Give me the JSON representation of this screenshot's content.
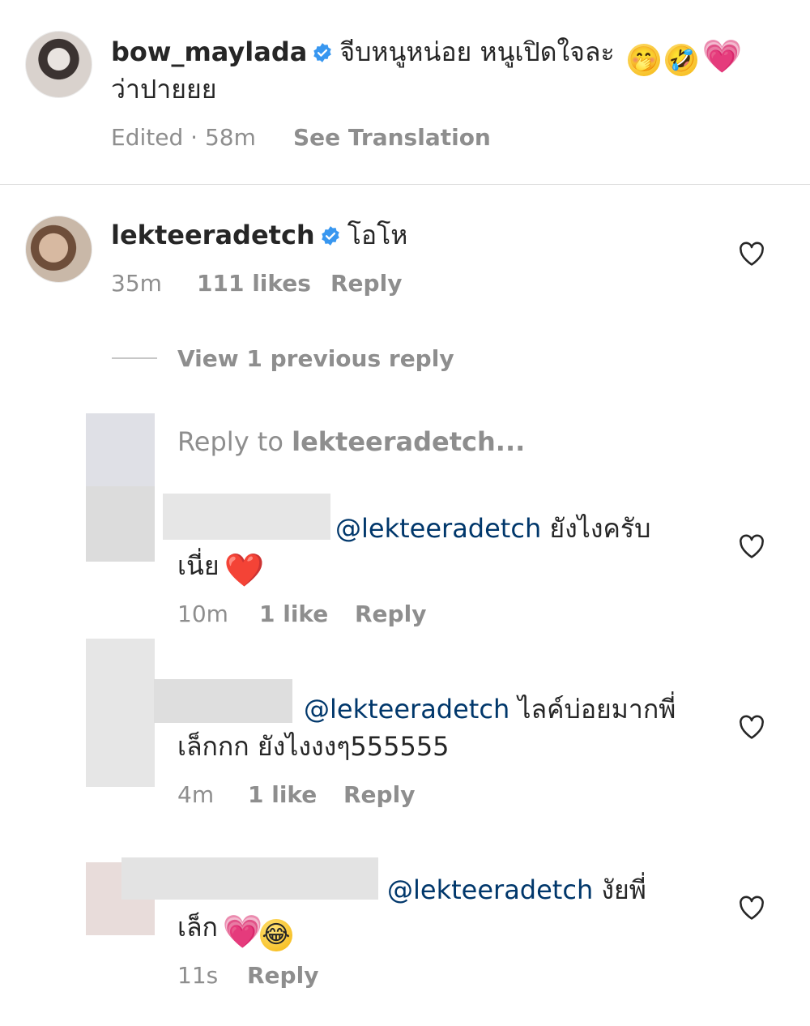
{
  "caption": {
    "username": "bow_maylada",
    "text_line1": "จีบหนูหน่อย หนูเปิดใจละ",
    "text_line2": "ว่าปายยย",
    "emojis": [
      "🤭",
      "🤣",
      "💗"
    ],
    "edited": "Edited",
    "time": "58m",
    "see_translation": "See Translation"
  },
  "comment": {
    "username": "lekteeradetch",
    "text": "โอโห",
    "time": "35m",
    "likes": "111 likes",
    "reply": "Reply",
    "view_previous": "View 1 previous reply",
    "reply_to": "Reply to",
    "reply_to_user": "lekteeradetch..."
  },
  "replies": [
    {
      "mention": "@lekteeradetch",
      "text_line1": "ยังไงครับ",
      "text_line2": "เนี่ย",
      "emoji": "❤️",
      "time": "10m",
      "likes": "1 like",
      "reply": "Reply"
    },
    {
      "mention": "@lekteeradetch",
      "text_line1": "ไลค์บ่อยมากพี่",
      "text_line2": "เล็กกก ยังไงงงๆ555555",
      "time": "4m",
      "likes": "1 like",
      "reply": "Reply"
    },
    {
      "mention": "@lekteeradetch",
      "text_line1": "งัยพี่",
      "text_line2": "เล็ก",
      "emojis": [
        "💗",
        "😂"
      ],
      "time": "11s",
      "reply": "Reply"
    }
  ],
  "colors": {
    "text": "#262626",
    "meta": "#8e8e8e",
    "mention": "#00376b",
    "verified": "#3897f0",
    "divider": "#dbdbdb"
  }
}
